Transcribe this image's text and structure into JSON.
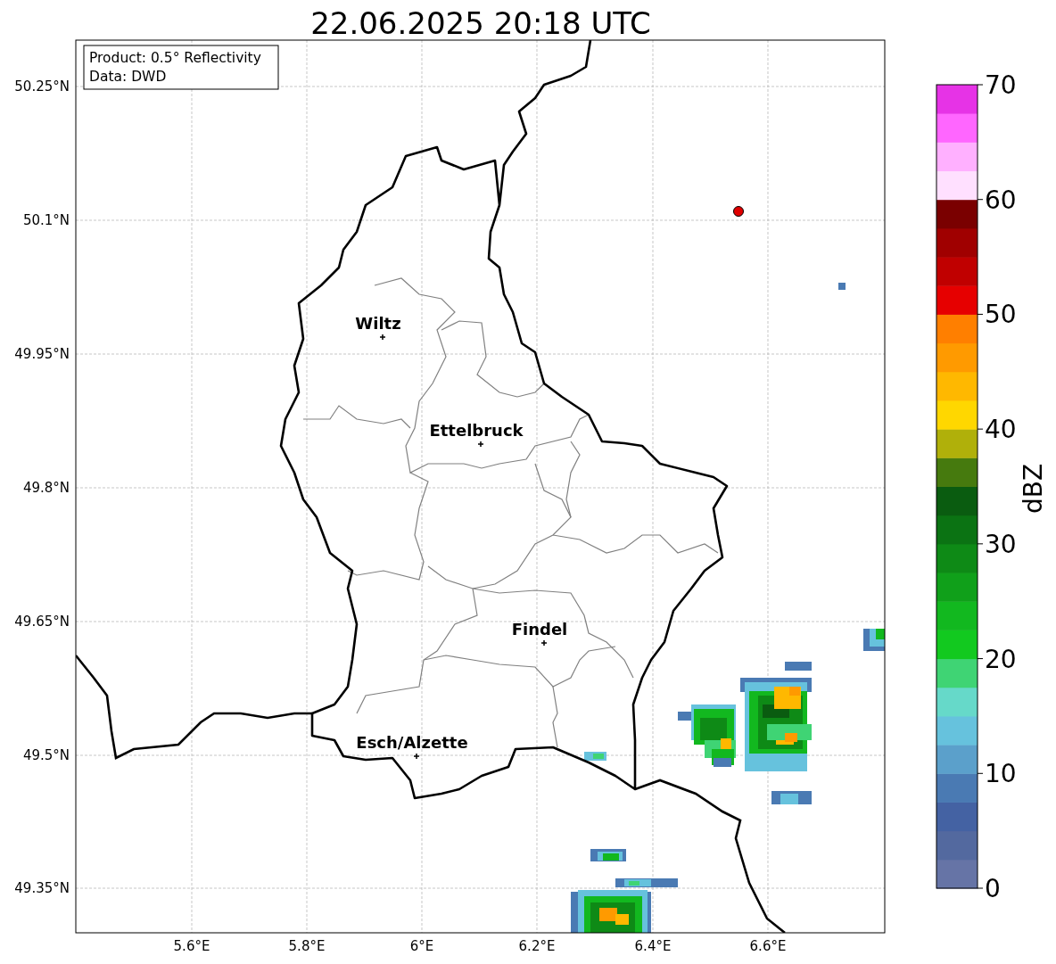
{
  "title": "22.06.2025 20:18 UTC",
  "info_box": {
    "lines": [
      "Product: 0.5° Reflectivity",
      "Data: DWD"
    ]
  },
  "map": {
    "y_tick_labels": [
      "50.25°N",
      "50.1°N",
      "49.95°N",
      "49.8°N",
      "49.65°N",
      "49.5°N",
      "49.35°N"
    ],
    "x_tick_labels": [
      "5.6°E",
      "5.8°E",
      "6°E",
      "6.2°E",
      "6.4°E",
      "6.6°E"
    ],
    "places": [
      {
        "label": "Wiltz"
      },
      {
        "label": "Ettelbruck"
      },
      {
        "label": "Findel"
      },
      {
        "label": "Esch/Alzette"
      }
    ]
  },
  "colorbar": {
    "label": "dBZ",
    "tick_labels": [
      "70",
      "60",
      "50",
      "40",
      "30",
      "20",
      "10",
      "0"
    ],
    "bins": [
      {
        "color": "#6674a6"
      },
      {
        "color": "#53699f"
      },
      {
        "color": "#4462a3"
      },
      {
        "color": "#4a7ab3"
      },
      {
        "color": "#5ba0cb"
      },
      {
        "color": "#66c2dd"
      },
      {
        "color": "#66d9c9"
      },
      {
        "color": "#3fd474"
      },
      {
        "color": "#12c91f"
      },
      {
        "color": "#12b81f"
      },
      {
        "color": "#10a01a"
      },
      {
        "color": "#0e8a16"
      },
      {
        "color": "#0b7313"
      },
      {
        "color": "#0a5c10"
      },
      {
        "color": "#467a0e"
      },
      {
        "color": "#b0b00a"
      },
      {
        "color": "#ffd700"
      },
      {
        "color": "#ffb800"
      },
      {
        "color": "#ff9a00"
      },
      {
        "color": "#ff7f00"
      },
      {
        "color": "#e60000"
      },
      {
        "color": "#c00000"
      },
      {
        "color": "#a00000"
      },
      {
        "color": "#7a0000"
      },
      {
        "color": "#ffe0ff"
      },
      {
        "color": "#ffb0ff"
      },
      {
        "color": "#ff66ff"
      },
      {
        "color": "#e633e6"
      }
    ]
  }
}
